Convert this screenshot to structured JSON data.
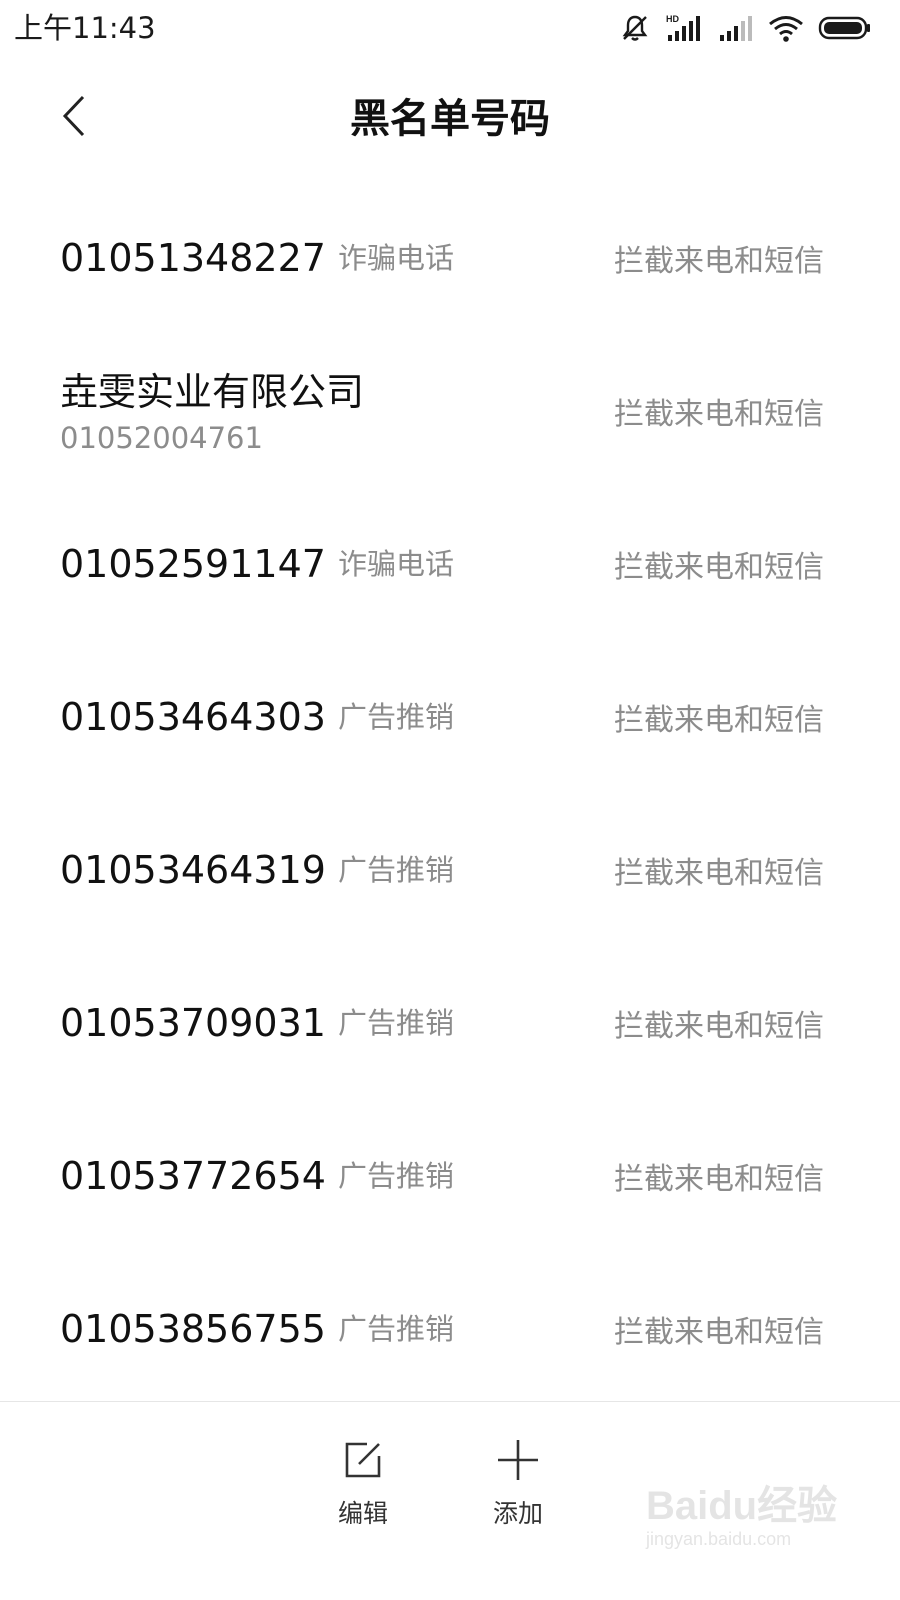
{
  "status_bar": {
    "time": "上午11:43",
    "network_label": "HD",
    "icons": [
      "mute-bell-icon",
      "hd-signal-icon",
      "signal-icon",
      "wifi-icon",
      "battery-icon"
    ]
  },
  "header": {
    "title": "黑名单号码",
    "back_icon": "chevron-left-icon"
  },
  "blacklist": [
    {
      "number": "01051348227",
      "tag": "诈骗电话",
      "action": "拦截来电和短信"
    },
    {
      "name": "垚雯实业有限公司",
      "number": "01052004761",
      "action": "拦截来电和短信"
    },
    {
      "number": "01052591147",
      "tag": "诈骗电话",
      "action": "拦截来电和短信"
    },
    {
      "number": "01053464303",
      "tag": "广告推销",
      "action": "拦截来电和短信"
    },
    {
      "number": "01053464319",
      "tag": "广告推销",
      "action": "拦截来电和短信"
    },
    {
      "number": "01053709031",
      "tag": "广告推销",
      "action": "拦截来电和短信"
    },
    {
      "number": "01053772654",
      "tag": "广告推销",
      "action": "拦截来电和短信"
    },
    {
      "number": "01053856755",
      "tag": "广告推销",
      "action": "拦截来电和短信"
    }
  ],
  "toolbar": {
    "edit_label": "编辑",
    "add_label": "添加"
  },
  "watermark": {
    "brand": "Baidu经验",
    "url": "jingyan.baidu.com"
  }
}
